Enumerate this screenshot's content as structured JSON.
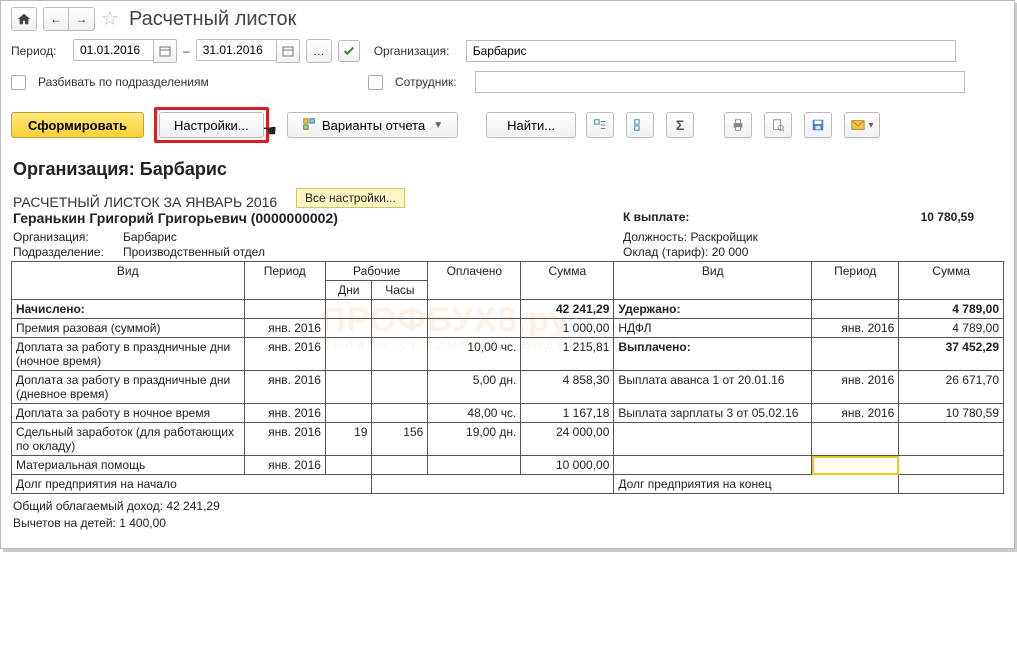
{
  "title": "Расчетный листок",
  "toolbar": {
    "period_label": "Период:",
    "dash": "–",
    "period_from": "01.01.2016",
    "period_to": "31.01.2016",
    "org_label": "Организация:",
    "org_value": "Барбарис",
    "split_label": "Разбивать по подразделениям",
    "emp_label": "Сотрудник:",
    "generate": "Сформировать",
    "settings": "Настройки...",
    "variants": "Варианты отчета",
    "find": "Найти...",
    "tooltip": "Все настройки..."
  },
  "report": {
    "org_title": "Организация: Барбарис",
    "header": "РАСЧЕТНЫЙ ЛИСТОК ЗА ЯНВАРЬ 2016",
    "employee": "Геранькин Григорий Григорьевич (0000000002)",
    "payout_label": "К выплате:",
    "payout_value": "10 780,59",
    "org_k": "Организация:",
    "org_v": "Барбарис",
    "dep_k": "Подразделение:",
    "dep_v": "Производственный отдел",
    "pos_k": "Должность:",
    "pos_v": "Раскройщик",
    "sal_k": "Оклад (тариф):",
    "sal_v": "20 000",
    "th": {
      "vid": "Вид",
      "period": "Период",
      "work": "Рабочие",
      "days": "Дни",
      "hours": "Часы",
      "paid": "Оплачено",
      "sum": "Сумма",
      "vid2": "Вид",
      "period2": "Период",
      "sum2": "Сумма"
    },
    "left": {
      "accrued": "Начислено:",
      "accrued_sum": "42 241,29",
      "rows": [
        {
          "name": "Премия разовая (суммой)",
          "period": "янв. 2016",
          "days": "",
          "hours": "",
          "paid": "",
          "sum": "1 000,00"
        },
        {
          "name": "Доплата за работу в праздничные дни (ночное время)",
          "period": "янв. 2016",
          "days": "",
          "hours": "",
          "paid": "10,00 чс.",
          "sum": "1 215,81"
        },
        {
          "name": "Доплата за работу в праздничные дни (дневное время)",
          "period": "янв. 2016",
          "days": "",
          "hours": "",
          "paid": "5,00 дн.",
          "sum": "4 858,30"
        },
        {
          "name": "Доплата за работу в ночное время",
          "period": "янв. 2016",
          "days": "",
          "hours": "",
          "paid": "48,00 чс.",
          "sum": "1 167,18"
        },
        {
          "name": "Сдельный заработок (для работающих по окладу)",
          "period": "янв. 2016",
          "days": "19",
          "hours": "156",
          "paid": "19,00 дн.",
          "sum": "24 000,00"
        },
        {
          "name": "Материальная помощь",
          "period": "янв. 2016",
          "days": "",
          "hours": "",
          "paid": "",
          "sum": "10 000,00"
        }
      ]
    },
    "right": {
      "held": "Удержано:",
      "held_sum": "4 789,00",
      "ndfl": "НДФЛ",
      "ndfl_p": "янв. 2016",
      "ndfl_s": "4 789,00",
      "paid": "Выплачено:",
      "paid_sum": "37 452,29",
      "rows": [
        {
          "name": "Выплата аванса 1 от 20.01.16",
          "period": "янв. 2016",
          "sum": "26 671,70"
        },
        {
          "name": "Выплата зарплаты 3 от 05.02.16",
          "period": "янв. 2016",
          "sum": "10 780,59"
        }
      ]
    },
    "debt_start": "Долг предприятия на начало",
    "debt_end": "Долг предприятия на конец",
    "footer1": "Общий облагаемый доход: 42 241,29",
    "footer2": "Вычетов на детей: 1 400,00"
  },
  "watermark": {
    "big": "ПРОФБУХ8.ру",
    "small": "ОНЛАЙН-СЕМИНАРЫ И ВИДЕОКУРСЫ 1С 8"
  }
}
